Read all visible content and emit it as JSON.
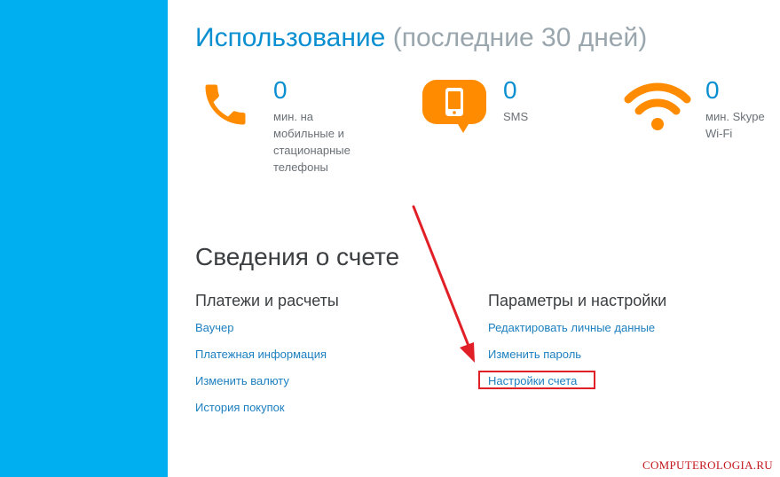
{
  "usage": {
    "title": "Использование",
    "subtitle": "(последние 30 дней)",
    "stats": [
      {
        "icon": "phone-icon",
        "value": "0",
        "label": "мин. на мобильные и стационарные телефоны"
      },
      {
        "icon": "sms-phone-icon",
        "value": "0",
        "label": "SMS"
      },
      {
        "icon": "wifi-icon",
        "value": "0",
        "label": "мин. Skype Wi-Fi"
      }
    ]
  },
  "account": {
    "title": "Сведения о счете",
    "payments": {
      "heading": "Платежи и расчеты",
      "links": [
        "Ваучер",
        "Платежная информация",
        "Изменить валюту",
        "История покупок"
      ]
    },
    "settings": {
      "heading": "Параметры и настройки",
      "links": [
        "Редактировать личные данные",
        "Изменить пароль",
        "Настройки счета"
      ]
    }
  },
  "watermark": "COMPUTEROLOGIA.RU",
  "colors": {
    "sidebar": "#00aff0",
    "accent_blue": "#0a8fd1",
    "icon_orange": "#ff8c00",
    "highlight_red": "#e11f26"
  }
}
